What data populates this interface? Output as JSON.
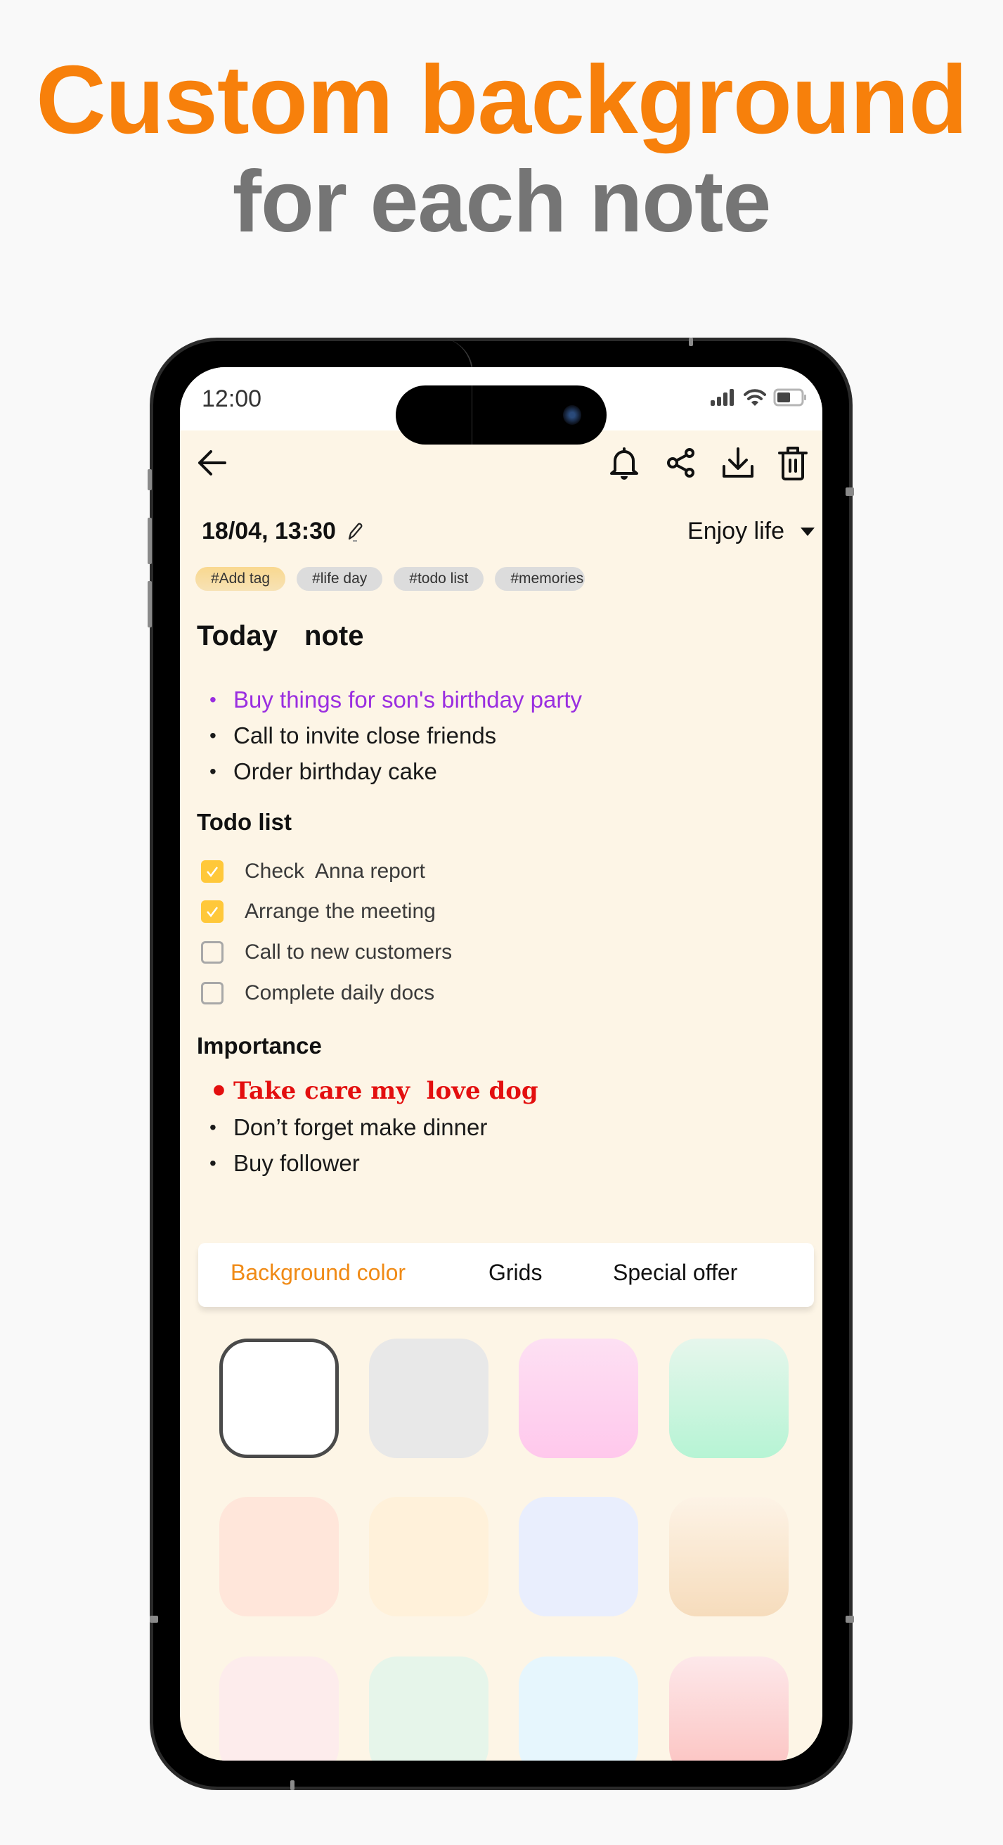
{
  "headline": {
    "line1": "Custom background",
    "line2": "for each note",
    "line1_color": "#f7800b",
    "line2_color": "#757575"
  },
  "status_bar": {
    "time": "12:00",
    "icons": [
      "signal-icon",
      "wifi-icon",
      "battery-icon"
    ]
  },
  "toolbar": {
    "back_icon": "arrow-left-icon",
    "actions": [
      {
        "name": "reminder",
        "icon": "bell-icon"
      },
      {
        "name": "share",
        "icon": "share-icon"
      },
      {
        "name": "download",
        "icon": "download-icon"
      },
      {
        "name": "delete",
        "icon": "trash-icon"
      }
    ]
  },
  "note_meta": {
    "datetime": "18/04, 13:30",
    "edit_icon": "pencil-icon",
    "category": "Enjoy life",
    "category_icon": "caret-down-icon"
  },
  "tags": [
    "#Add tag",
    "#life day",
    "#todo list",
    "#memories"
  ],
  "note": {
    "title": "Today  note",
    "bullets": [
      {
        "text": "Buy things for son's birthday party",
        "color": "#9a2ee0"
      },
      {
        "text": "Call to invite close friends",
        "color": "#1a1a1a"
      },
      {
        "text": "Order birthday cake",
        "color": "#1a1a1a"
      }
    ],
    "todo_header": "Todo list",
    "todos": [
      {
        "text": "Check  Anna report",
        "checked": true
      },
      {
        "text": "Arrange the meeting",
        "checked": true
      },
      {
        "text": "Call to new customers",
        "checked": false
      },
      {
        "text": "Complete daily docs",
        "checked": false
      }
    ],
    "importance_header": "Importance",
    "importance": [
      {
        "text": "Take care my  love dog",
        "color": "#e30f0f"
      },
      {
        "text": "Don’t forget make dinner",
        "color": "#1a1a1a"
      },
      {
        "text": "Buy follower",
        "color": "#1a1a1a"
      }
    ]
  },
  "background_panel": {
    "tabs": [
      {
        "label": "Background color",
        "active": true
      },
      {
        "label": "Grids",
        "active": false
      },
      {
        "label": "Special offer",
        "active": false
      }
    ],
    "active_color": "#f08a15",
    "swatches": [
      {
        "name": "white",
        "fill": "#ffffff",
        "selected": true
      },
      {
        "name": "light-gray",
        "fill": "#e8e8e8",
        "selected": false
      },
      {
        "name": "pink-gradient",
        "fill": "linear-gradient(#fde0f3,#ffc8ec)",
        "selected": false
      },
      {
        "name": "mint-gradient",
        "fill": "linear-gradient(#e6f6ec,#b6f4d4)",
        "selected": false
      },
      {
        "name": "peach",
        "fill": "#ffe6da",
        "selected": false
      },
      {
        "name": "cream",
        "fill": "#fff1da",
        "selected": false
      },
      {
        "name": "lavender",
        "fill": "#e9eefd",
        "selected": false
      },
      {
        "name": "sand-gradient",
        "fill": "linear-gradient(#fdf3e6,#f6dcbc)",
        "selected": false
      },
      {
        "name": "blush",
        "fill": "#fdecec",
        "selected": false
      },
      {
        "name": "pale-green",
        "fill": "#e6f5ea",
        "selected": false
      },
      {
        "name": "ice-blue",
        "fill": "#e6f6fd",
        "selected": false
      },
      {
        "name": "rose-gradient",
        "fill": "linear-gradient(#fde8ea,#fcc2c0)",
        "selected": false
      }
    ]
  },
  "colors": {
    "note_background": "#fdf5e6",
    "checkbox_checked": "#ffc83a"
  }
}
